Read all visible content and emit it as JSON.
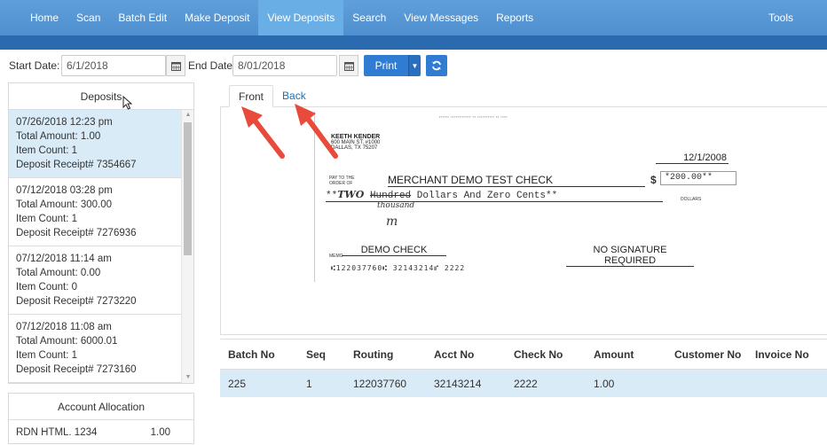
{
  "nav": {
    "items": [
      "Home",
      "Scan",
      "Batch Edit",
      "Make Deposit",
      "View Deposits",
      "Search",
      "View Messages",
      "Reports"
    ],
    "active": "View Deposits",
    "tools": "Tools"
  },
  "filters": {
    "start_label": "Start Date:",
    "start_value": "6/1/2018",
    "end_label": "End Date:",
    "end_value": "8/01/2018",
    "print_label": "Print"
  },
  "deposits": {
    "title": "Deposits",
    "items": [
      {
        "date": "07/26/2018 12:23 pm",
        "total": "Total Amount: 1.00",
        "count": "Item Count: 1",
        "receipt": "Deposit Receipt# 7354667"
      },
      {
        "date": "07/12/2018 03:28 pm",
        "total": "Total Amount: 300.00",
        "count": "Item Count: 1",
        "receipt": "Deposit Receipt# 7276936"
      },
      {
        "date": "07/12/2018 11:14 am",
        "total": "Total Amount: 0.00",
        "count": "Item Count: 0",
        "receipt": "Deposit Receipt# 7273220"
      },
      {
        "date": "07/12/2018 11:08 am",
        "total": "Total Amount: 6000.01",
        "count": "Item Count: 1",
        "receipt": "Deposit Receipt# 7273160"
      }
    ]
  },
  "allocation": {
    "title": "Account Allocation",
    "rows": [
      {
        "name": "RDN HTML. 1234",
        "amount": "1.00"
      }
    ]
  },
  "image_tabs": {
    "front": "Front",
    "back": "Back"
  },
  "check": {
    "payer_name": "KEETH KENDER",
    "payer_addr1": "600 MAIN ST. #1000",
    "payer_addr2": "DALLAS, TX 75207",
    "date": "12/1/2008",
    "pay_to_1": "PAY TO THE",
    "pay_to_2": "ORDER OF",
    "payee": "MERCHANT DEMO TEST CHECK",
    "dollar_sign": "$",
    "amount": "*200.00**",
    "written_prefix": "**",
    "written_hand": "TWO",
    "written_struck": "Hundred",
    "written_rest": " Dollars And Zero Cents**",
    "hand_note": "thousand",
    "hand_initials": "m",
    "dollars_word": "DOLLARS",
    "memo_label": "MEMO",
    "memo": "DEMO CHECK",
    "signature": "NO SIGNATURE REQUIRED",
    "micr": "⑆122037760⑆ 32143214⑈ 2222"
  },
  "items_table": {
    "columns": [
      "Batch No",
      "Seq",
      "Routing",
      "Acct No",
      "Check No",
      "Amount",
      "Customer No",
      "Invoice No"
    ],
    "rows": [
      [
        "225",
        "1",
        "122037760",
        "32143214",
        "2222",
        "1.00",
        "",
        ""
      ]
    ]
  },
  "colors": {
    "nav": "#5b9bd5",
    "accent": "#2f7cd2",
    "selected_row": "#d9ebf7",
    "arrow": "#e84b3c"
  }
}
